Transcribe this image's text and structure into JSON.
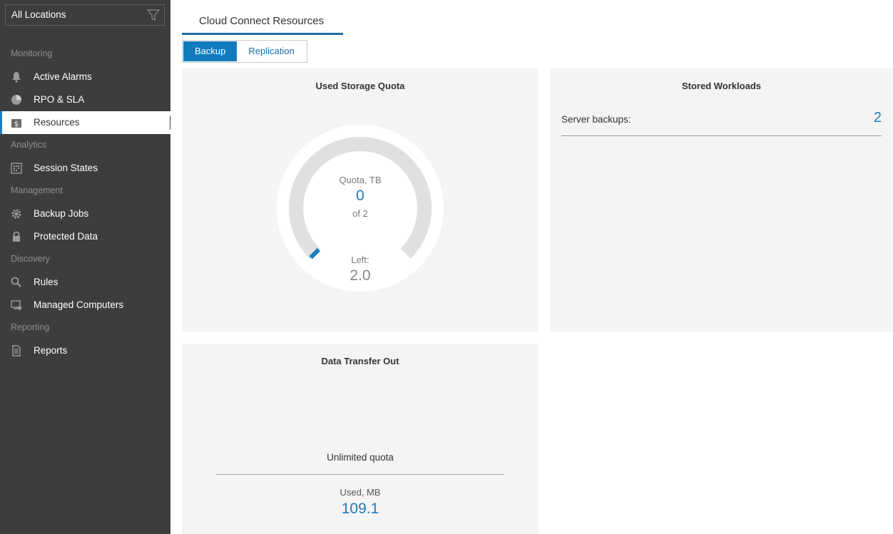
{
  "sidebar": {
    "location_select": "All Locations",
    "sections": {
      "monitoring": "Monitoring",
      "analytics": "Analytics",
      "management": "Management",
      "discovery": "Discovery",
      "reporting": "Reporting"
    },
    "items": {
      "active_alarms": "Active Alarms",
      "rpo_sla": "RPO & SLA",
      "resources": "Resources",
      "session_states": "Session States",
      "backup_jobs": "Backup Jobs",
      "protected_data": "Protected Data",
      "rules": "Rules",
      "managed_computers": "Managed Computers",
      "reports": "Reports"
    },
    "active_item": "Resources"
  },
  "header": {
    "tab_title": "Cloud Connect Resources",
    "segments": [
      "Backup",
      "Replication"
    ],
    "selected_segment": "Backup"
  },
  "used_storage_quota": {
    "title": "Used Storage Quota",
    "quota_label": "Quota, TB",
    "used_value": "0",
    "of_label": "of 2",
    "left_label": "Left:",
    "left_value": "2.0",
    "used_fraction": 0.0
  },
  "stored_workloads": {
    "title": "Stored Workloads",
    "server_backups_label": "Server backups:",
    "server_backups_value": "2"
  },
  "data_transfer_out": {
    "title": "Data Transfer Out",
    "quota_text": "Unlimited quota",
    "used_label": "Used, MB",
    "used_value": "109.1"
  },
  "colors": {
    "sidebar_bg": "#3d3d3d",
    "accent": "#0f7bbd",
    "value_blue": "#1e7ab8",
    "card_bg": "#f4f4f4"
  }
}
